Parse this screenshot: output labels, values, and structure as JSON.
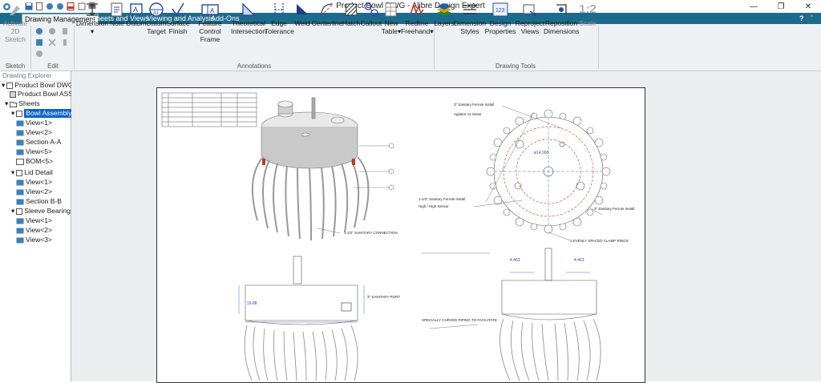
{
  "window": {
    "title": "Product Bowl DWG - Alibre Design Expert"
  },
  "tabs": [
    "Drawing Management",
    "Sheets and Views",
    "Viewing and Analysis",
    "Add-Ons"
  ],
  "ribbon": {
    "sketch": {
      "label1": "Activate",
      "label2": "2D Sketch",
      "group": "Sketch"
    },
    "edit_group": "Edit",
    "annotations": [
      {
        "l1": "Dimension",
        "l2": "▾"
      },
      {
        "l1": "Note",
        "l2": ""
      },
      {
        "l1": "Datum",
        "l2": ""
      },
      {
        "l1": "Datum",
        "l2": "Target"
      },
      {
        "l1": "Surface",
        "l2": "Finish"
      },
      {
        "l1": "Feature",
        "l2": "Control Frame"
      },
      {
        "l1": "Theoretical",
        "l2": "Intersection"
      },
      {
        "l1": "Edge",
        "l2": "Tolerance"
      },
      {
        "l1": "Weld",
        "l2": ""
      },
      {
        "l1": "Centerline",
        "l2": ""
      },
      {
        "l1": "Hatch",
        "l2": ""
      },
      {
        "l1": "Callout",
        "l2": ""
      },
      {
        "l1": "New",
        "l2": "Table▾"
      },
      {
        "l1": "Redline",
        "l2": "Freehand▾"
      }
    ],
    "annotations_group": "Annotations",
    "tools": [
      {
        "l1": "Layers",
        "l2": ""
      },
      {
        "l1": "Dimension",
        "l2": "Styles"
      },
      {
        "l1": "Design",
        "l2": "Properties"
      },
      {
        "l1": "Reproject",
        "l2": "Views"
      },
      {
        "l1": "Reposition",
        "l2": "Dimensions"
      },
      {
        "l1": "Scale",
        "l2": ""
      }
    ],
    "scale_icon_text": "1:2",
    "tools_group": "Drawing Tools"
  },
  "explorer": {
    "title": "Drawing Explorer",
    "root": "Product Bowl DWG",
    "assy": "Product Bowl ASSY",
    "sheets_label": "Sheets",
    "bowl_assembly": "Bowl Assembly",
    "bowl_views": [
      "View<1>",
      "View<2>",
      "Section A-A",
      "View<5>",
      "BOM<5>"
    ],
    "lid_detail": "Lid Detail",
    "lid_views": [
      "View<1>",
      "View<2>",
      "Section B-B"
    ],
    "sleeve_bearing": "Sleeve Bearing",
    "sleeve_views": [
      "View<1>",
      "View<2>",
      "View<3>"
    ]
  },
  "drawing": {
    "note_sanitary": "1-1/2\" SANITARY CONNECTION",
    "note_ferrule3": "3\" Sanitary Ferrule Install",
    "note_agitator": "Agitator Air Motor",
    "note_ferrule15": "1-1/2\" Sanitary Ferrule Install",
    "note_sensor": "High / High Sensor",
    "note_radar": "3\" Sanitary Ferrule Install",
    "note_clamp": "3 EVENLY SPACED CLAMP RINGS",
    "note_piping": "SPECIALLY CURVED PIPING TO FACILITATE",
    "note_float": "3\" SANITARY PORT",
    "dim_a": "4.463",
    "dim_b": "4.463",
    "dim_c": "19.88",
    "dim_d": "ø14.000"
  },
  "colors": {
    "tabbar": "#1d6b8c",
    "selection": "#0a64c8",
    "accent_red": "#c0392b",
    "dim_blue": "#2748a8"
  }
}
